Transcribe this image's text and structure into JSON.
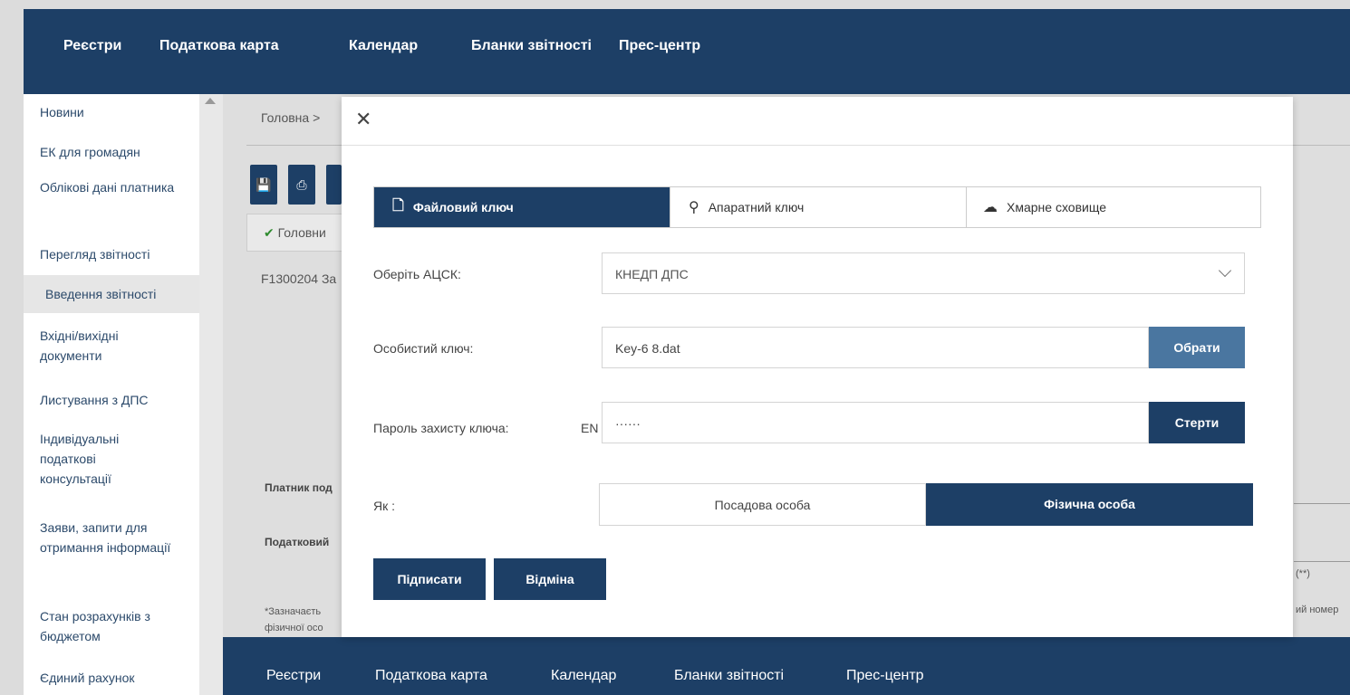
{
  "top_nav": [
    "Реєстри",
    "Податкова карта",
    "Календар",
    "Бланки звітності",
    "Прес-центр"
  ],
  "sidebar": {
    "items": [
      {
        "label": "Новини"
      },
      {
        "label": "ЕК для громадян"
      },
      {
        "label": "Облікові дані платника"
      },
      {
        "label": "Перегляд звітності"
      },
      {
        "label": "Введення звітності",
        "active": true
      },
      {
        "label": "Вхідні/вихідні документи"
      },
      {
        "label": "Листування з ДПС"
      },
      {
        "label": "Індивідуальні податкові консультації"
      },
      {
        "label": "Заяви, запити для отримання інформації"
      },
      {
        "label": "Стан розрахунків з бюджетом"
      },
      {
        "label": "Єдиний рахунок"
      }
    ]
  },
  "background": {
    "breadcrumb": "Головна",
    "tab_label": "Головни",
    "doc_label": "F1300204 За",
    "payer_label": "Платник под",
    "tax_label": "Податковий",
    "note_line1": "*Зазначаєть",
    "note_line2": "фізичної осо",
    "right_fragment1": "(**)",
    "right_fragment2": "ий номер"
  },
  "modal": {
    "tabs": [
      {
        "label": "Файловий ключ",
        "icon": "file-icon",
        "active": true
      },
      {
        "label": "Апаратний ключ",
        "icon": "key-icon"
      },
      {
        "label": "Хмарне сховище",
        "icon": "cloud-icon"
      }
    ],
    "acsk_label": "Оберіть АЦСК:",
    "acsk_value": "КНЕДП ДПС",
    "key_label": "Особистий ключ:",
    "key_value": "Key-6 8.dat",
    "choose_button": "Обрати",
    "password_label": "Пароль захисту ключа:",
    "lang_indicator": "EN",
    "password_value": "······",
    "clear_button": "Стерти",
    "role_label": "Як :",
    "role_options": [
      "Посадова особа",
      "Фізична особа"
    ],
    "role_selected": "Фізична особа",
    "sign_button": "Підписати",
    "cancel_button": "Відміна"
  },
  "bottom_nav": [
    "Реєстри",
    "Податкова карта",
    "Календар",
    "Бланки звітності",
    "Прес-центр"
  ],
  "colors": {
    "primary": "#1d3f66",
    "button_light": "#4a76a0"
  }
}
